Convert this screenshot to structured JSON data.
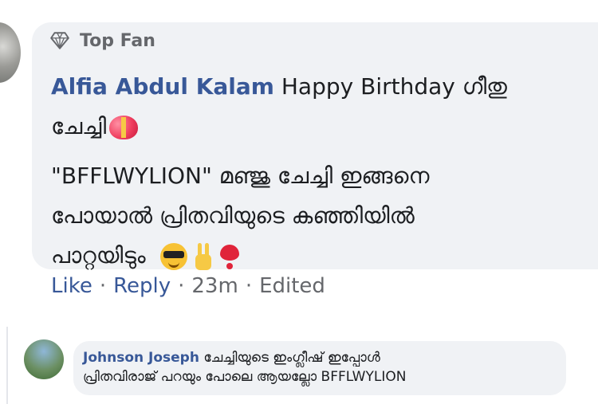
{
  "comment": {
    "badge_label": "Top Fan",
    "badge_icon": "diamond-icon",
    "author": "Alfia Abdul Kalam",
    "text_line1": "Happy Birthday ഗീതു",
    "text_line2": "ചേച്ചി",
    "para2_line1": "\"BFFLWYLION\" മഞ്ജു ചേച്ചി ഇങ്ങനെ",
    "para2_line2": "പോയാൽ പ്രിതവിയുടെ കഞ്ഞിയിൽ",
    "para2_line3": "പാറ്റയിടും",
    "actions": {
      "like": "Like",
      "reply": "Reply",
      "time": "23m",
      "edited": "Edited",
      "separator": "·"
    }
  },
  "reply": {
    "author": "Johnson Joseph",
    "text_line1": "ചേച്ചിയുടെ ഇംഗ്ലീഷ് ഇപ്പോൾ",
    "text_line2": "പ്രിതവിരാജ് പറയും പോലെ ആയല്ലോ BFFLWYLION"
  },
  "colors": {
    "author_link": "#385898",
    "secondary_text": "#65676b",
    "bubble_bg": "#f0f2f5"
  }
}
